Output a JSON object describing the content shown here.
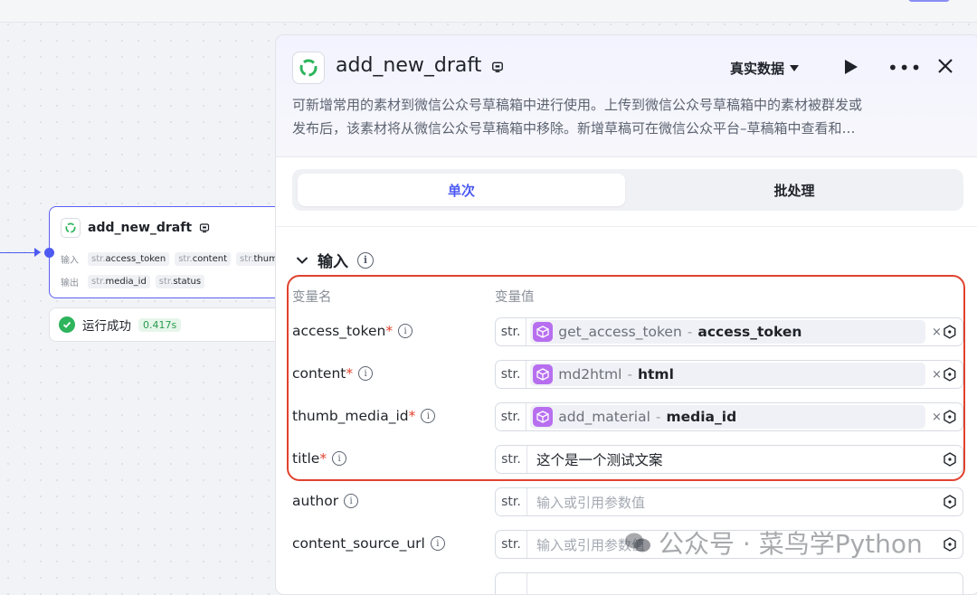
{
  "node": {
    "title": "add_new_draft",
    "input_label": "输入",
    "output_label": "输出",
    "inputs": [
      {
        "type": "str.",
        "name": "access_token"
      },
      {
        "type": "str.",
        "name": "content"
      },
      {
        "type": "str.",
        "name": "thum"
      }
    ],
    "outputs": [
      {
        "type": "str.",
        "name": "media_id"
      },
      {
        "type": "str.",
        "name": "status"
      }
    ]
  },
  "run_status": {
    "text": "运行成功",
    "time": "0.417s"
  },
  "panel": {
    "title": "add_new_draft",
    "mode": "真实数据",
    "description_line1": "可新增常用的素材到微信公众号草稿箱中进行使用。上传到微信公众号草稿箱中的素材被群发或",
    "description_line2": "发布后，该素材将从微信公众号草稿箱中移除。新增草稿可在微信公众平台–草稿箱中查看和…",
    "tabs": [
      "单次",
      "批处理"
    ],
    "section_title": "输入",
    "col_name": "变量名",
    "col_value": "变量值",
    "params": [
      {
        "name": "access_token",
        "required": "*",
        "type": "str.",
        "ref_source": "get_access_token",
        "ref_sep": "-",
        "ref_output": "access_token",
        "clear": "×"
      },
      {
        "name": "content",
        "required": "*",
        "type": "str.",
        "ref_source": "md2html",
        "ref_sep": "-",
        "ref_output": "html",
        "clear": "×"
      },
      {
        "name": "thumb_media_id",
        "required": "*",
        "type": "str.",
        "ref_source": "add_material",
        "ref_sep": "-",
        "ref_output": "media_id",
        "clear": "×"
      },
      {
        "name": "title",
        "required": "*",
        "type": "str.",
        "value": "这个是一个测试文案"
      },
      {
        "name": "author",
        "type": "str.",
        "placeholder": "输入或引用参数值"
      },
      {
        "name": "content_source_url",
        "type": "str.",
        "placeholder": "输入或引用参数值"
      }
    ]
  },
  "watermark": "公众号 · 菜鸟学Python",
  "colors": {
    "accent": "#4e5bf2",
    "highlight": "#e0422f",
    "success": "#2db45c",
    "ref_icon": "#b76ff0"
  }
}
